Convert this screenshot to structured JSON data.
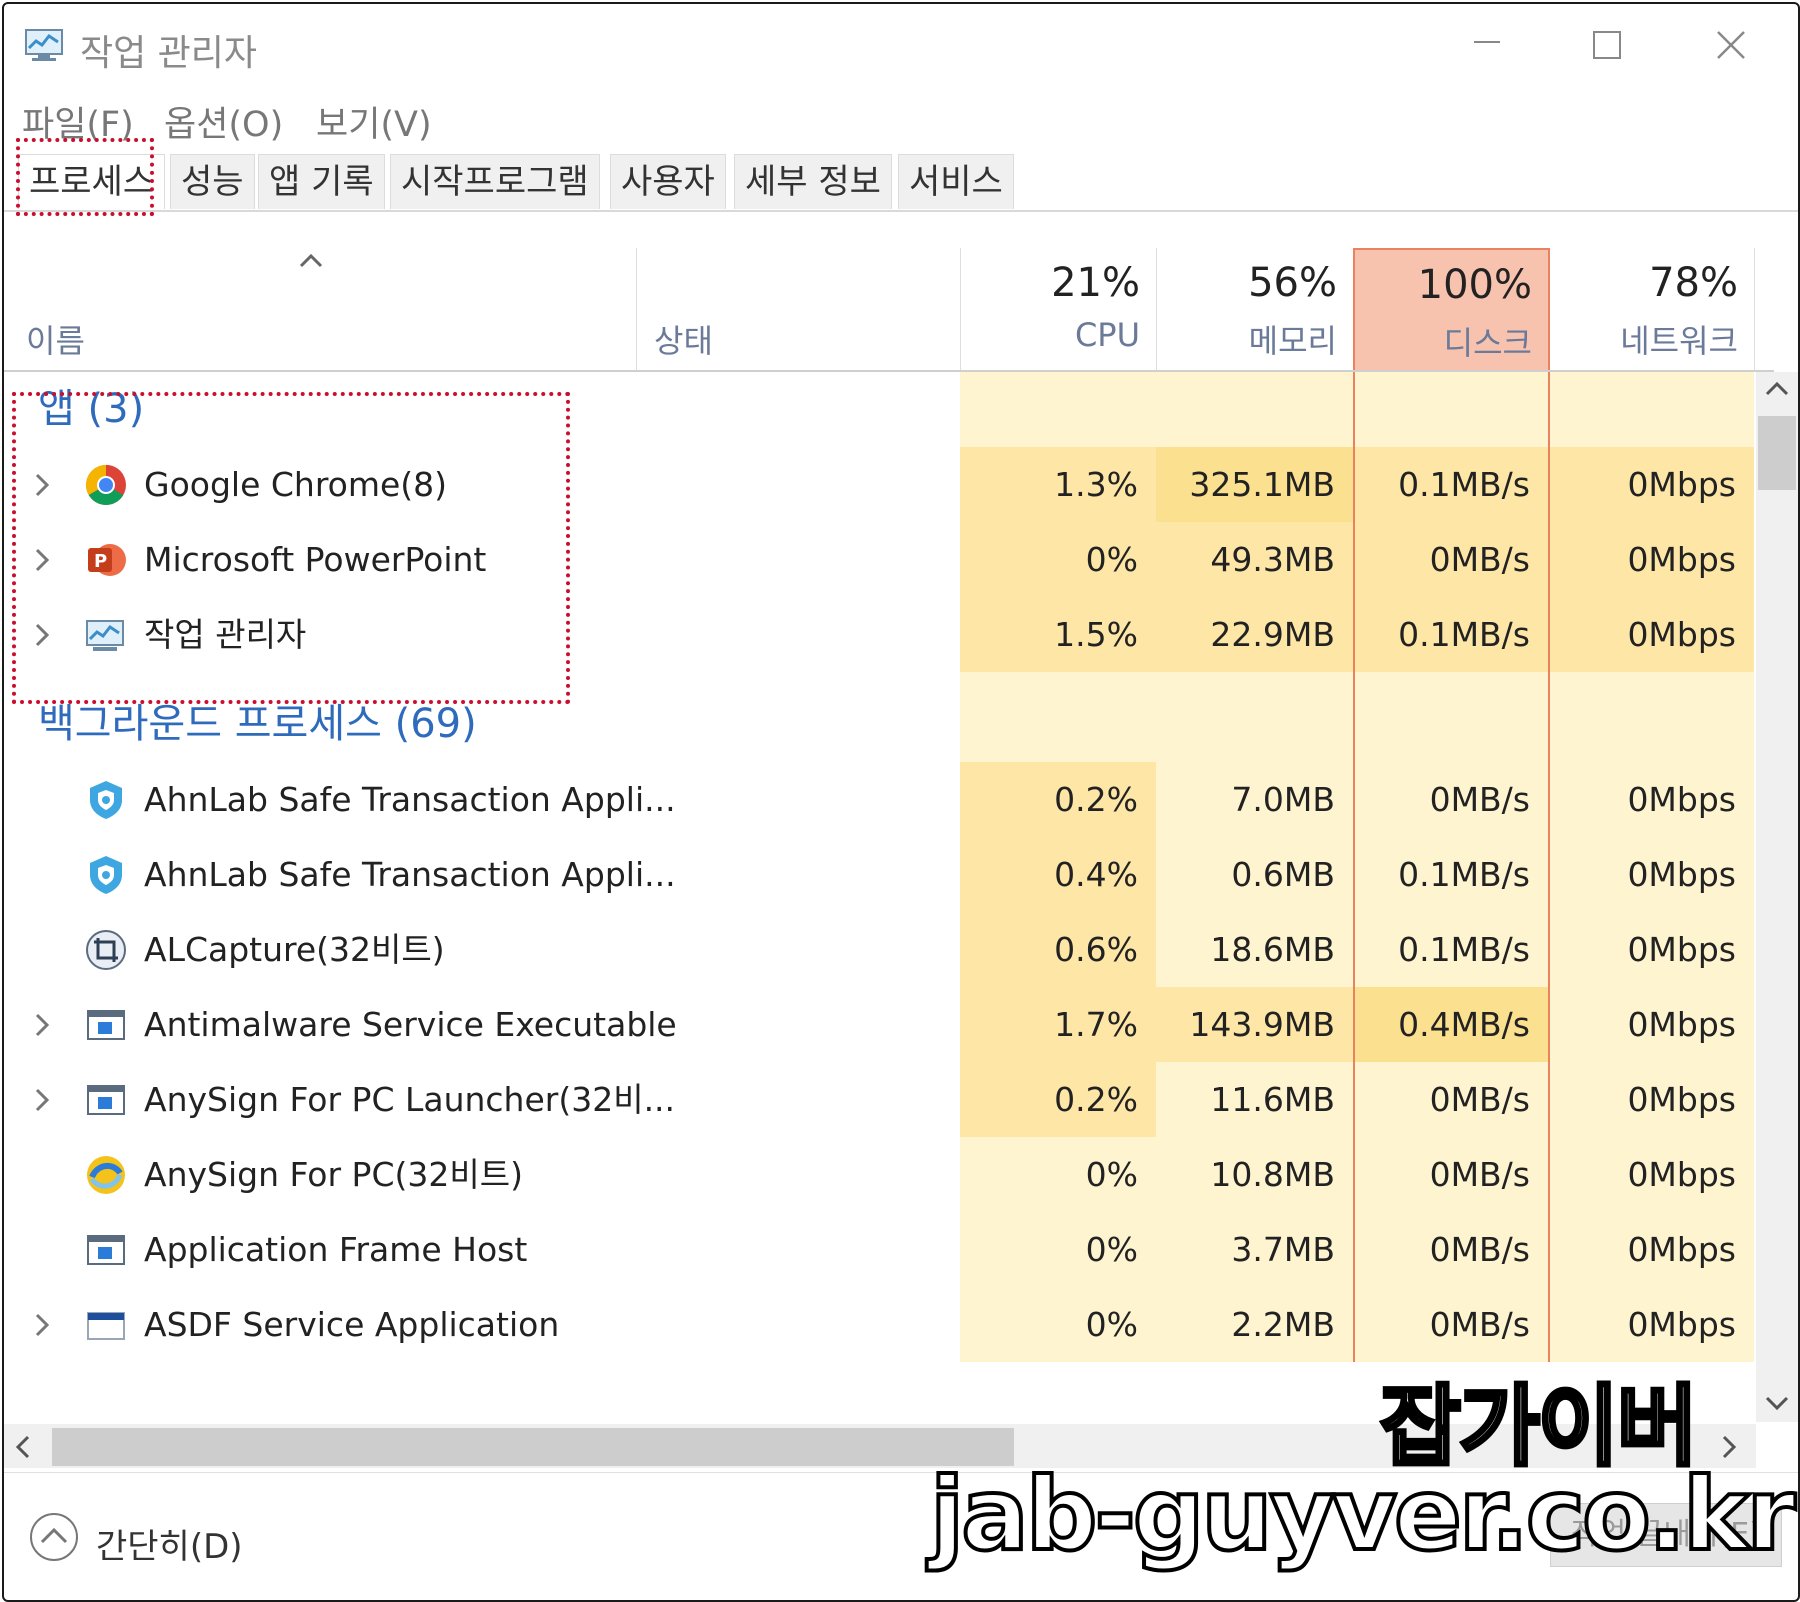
{
  "window": {
    "title": "작업 관리자"
  },
  "menu": {
    "file": "파일(F)",
    "options": "옵션(O)",
    "view": "보기(V)"
  },
  "tabs": [
    "프로세스",
    "성능",
    "앱 기록",
    "시작프로그램",
    "사용자",
    "세부 정보",
    "서비스"
  ],
  "header": {
    "name": "이름",
    "status": "상태",
    "cpu_pct": "21%",
    "cpu": "CPU",
    "mem_pct": "56%",
    "mem": "메모리",
    "disk_pct": "100%",
    "disk": "디스크",
    "net_pct": "78%",
    "net": "네트워크"
  },
  "groups": {
    "apps": "앱 (3)",
    "background": "백그라운드 프로세스 (69)"
  },
  "apps": [
    {
      "name": "Google Chrome(8)",
      "cpu": "1.3%",
      "mem": "325.1MB",
      "disk": "0.1MB/s",
      "net": "0Mbps",
      "icon": "chrome-icon"
    },
    {
      "name": "Microsoft PowerPoint",
      "cpu": "0%",
      "mem": "49.3MB",
      "disk": "0MB/s",
      "net": "0Mbps",
      "icon": "powerpoint-icon"
    },
    {
      "name": "작업 관리자",
      "cpu": "1.5%",
      "mem": "22.9MB",
      "disk": "0.1MB/s",
      "net": "0Mbps",
      "icon": "task-manager-icon"
    }
  ],
  "background": [
    {
      "name": "AhnLab Safe Transaction Appli...",
      "cpu": "0.2%",
      "mem": "7.0MB",
      "disk": "0MB/s",
      "net": "0Mbps",
      "icon": "shield-icon"
    },
    {
      "name": "AhnLab Safe Transaction Appli...",
      "cpu": "0.4%",
      "mem": "0.6MB",
      "disk": "0.1MB/s",
      "net": "0Mbps",
      "icon": "shield-icon"
    },
    {
      "name": "ALCapture(32비트)",
      "cpu": "0.6%",
      "mem": "18.6MB",
      "disk": "0.1MB/s",
      "net": "0Mbps",
      "icon": "capture-icon"
    },
    {
      "name": "Antimalware Service Executable",
      "cpu": "1.7%",
      "mem": "143.9MB",
      "disk": "0.4MB/s",
      "net": "0Mbps",
      "icon": "window-app-icon"
    },
    {
      "name": "AnySign For PC Launcher(32비...",
      "cpu": "0.2%",
      "mem": "11.6MB",
      "disk": "0MB/s",
      "net": "0Mbps",
      "icon": "window-app-icon"
    },
    {
      "name": "AnySign For PC(32비트)",
      "cpu": "0%",
      "mem": "10.8MB",
      "disk": "0MB/s",
      "net": "0Mbps",
      "icon": "anysign-icon"
    },
    {
      "name": "Application Frame Host",
      "cpu": "0%",
      "mem": "3.7MB",
      "disk": "0MB/s",
      "net": "0Mbps",
      "icon": "window-app-icon"
    },
    {
      "name": "ASDF Service Application",
      "cpu": "0%",
      "mem": "2.2MB",
      "disk": "0MB/s",
      "net": "0Mbps",
      "icon": "asdf-icon"
    }
  ],
  "footer": {
    "fewer_details": "간단히(D)",
    "end_task": "작업 끝내기(E)"
  },
  "watermark": {
    "line1": "잡가이버",
    "line2": "jab-guyver.co.kr"
  }
}
